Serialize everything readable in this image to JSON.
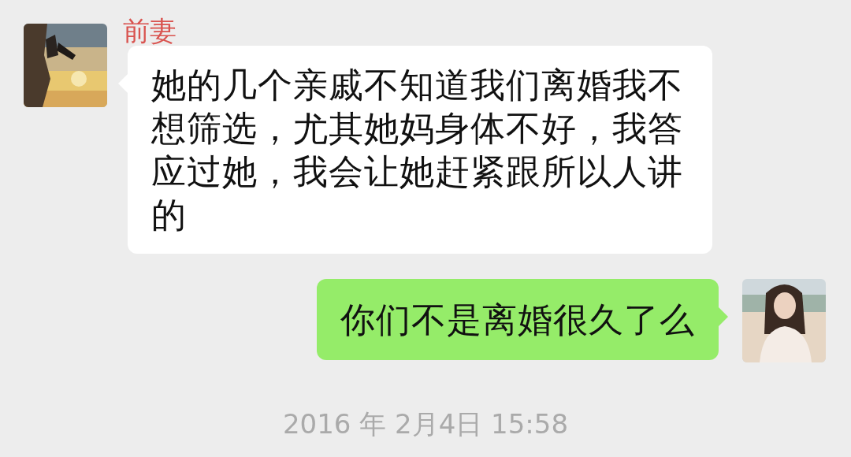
{
  "messages": [
    {
      "kind": "incoming",
      "sender": "前妻",
      "text": "她的几个亲戚不知道我们离婚我不想筛选，尤其她妈身体不好，我答应过她，我会让她赶紧跟所以人讲的"
    },
    {
      "kind": "outgoing",
      "text": "你们不是离婚很久了么"
    }
  ],
  "timestamp": "2016 年 2月4日 15:58"
}
